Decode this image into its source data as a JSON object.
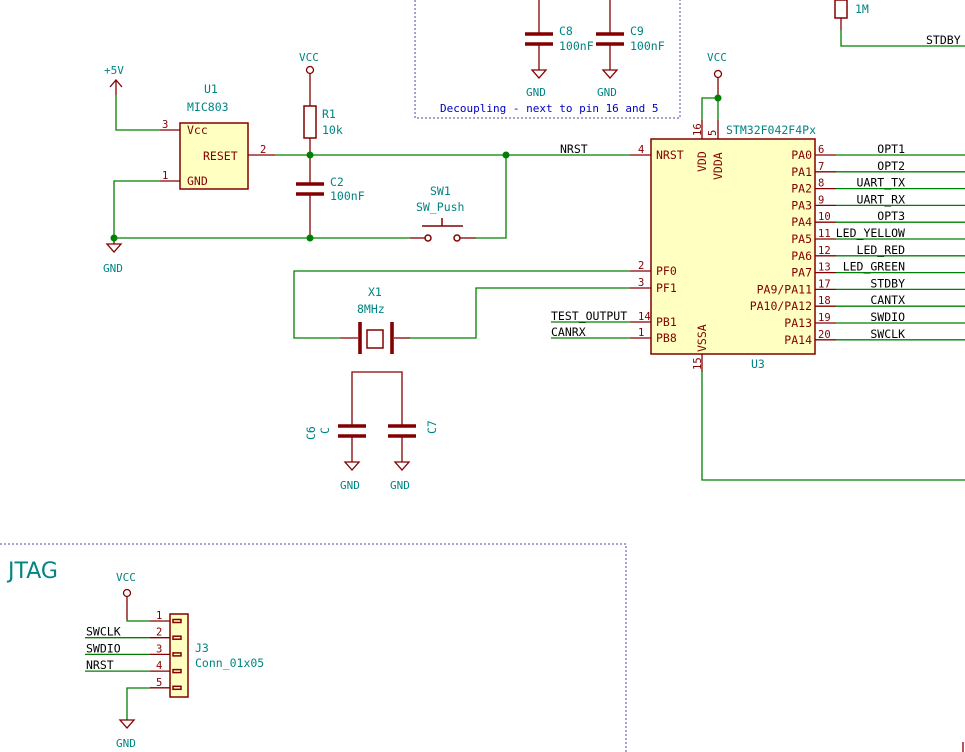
{
  "labels": {
    "plus5v": "+5V",
    "vcc": "VCC",
    "gnd": "GND",
    "decoupling_note": "Decoupling - next to pin 16 and 5",
    "jtag_title": "JTAG"
  },
  "components": {
    "u1": {
      "ref": "U1",
      "value": "MIC803",
      "pins": {
        "vcc": "Vcc",
        "reset": "RESET",
        "gnd": "GND",
        "n3": "3",
        "n2": "2",
        "n1": "1"
      }
    },
    "r1": {
      "ref": "R1",
      "value": "10k"
    },
    "c2": {
      "ref": "C2",
      "value": "100nF"
    },
    "sw1": {
      "ref": "SW1",
      "value": "SW_Push"
    },
    "x1": {
      "ref": "X1",
      "value": "8MHz"
    },
    "c6": {
      "ref": "C6",
      "value": "C"
    },
    "c7": {
      "ref": "C7",
      "value": "C"
    },
    "c8": {
      "ref": "C8",
      "value": "100nF"
    },
    "c9": {
      "ref": "C9",
      "value": "100nF"
    },
    "r_top": {
      "value": "1M"
    },
    "u3": {
      "ref": "U3",
      "value": "STM32F042F4Px",
      "left_pins": [
        {
          "name": "NRST",
          "num": "4"
        },
        {
          "name": "PF0",
          "num": "2"
        },
        {
          "name": "PF1",
          "num": "3"
        },
        {
          "name": "PB1",
          "num": "14"
        },
        {
          "name": "PB8",
          "num": "1"
        }
      ],
      "right_pins": [
        {
          "name": "PA0",
          "num": "6",
          "net": "OPT1"
        },
        {
          "name": "PA1",
          "num": "7",
          "net": "OPT2"
        },
        {
          "name": "PA2",
          "num": "8",
          "net": "UART_TX"
        },
        {
          "name": "PA3",
          "num": "9",
          "net": "UART_RX"
        },
        {
          "name": "PA4",
          "num": "10",
          "net": "OPT3"
        },
        {
          "name": "PA5",
          "num": "11",
          "net": "LED_YELLOW"
        },
        {
          "name": "PA6",
          "num": "12",
          "net": "LED_RED"
        },
        {
          "name": "PA7",
          "num": "13",
          "net": "LED_GREEN"
        },
        {
          "name": "PA9/PA11",
          "num": "17",
          "net": "STDBY"
        },
        {
          "name": "PA10/PA12",
          "num": "18",
          "net": "CANTX"
        },
        {
          "name": "PA13",
          "num": "19",
          "net": "SWDIO"
        },
        {
          "name": "PA14",
          "num": "20",
          "net": "SWCLK"
        }
      ],
      "top_pins": [
        {
          "name": "VDD",
          "num": "16"
        },
        {
          "name": "VDDA",
          "num": "5"
        }
      ],
      "bottom_pins": [
        {
          "name": "VSSA",
          "num": "15"
        }
      ]
    },
    "j3": {
      "ref": "J3",
      "value": "Conn_01x05",
      "pins": [
        {
          "num": "1",
          "net": ""
        },
        {
          "num": "2",
          "net": "SWCLK"
        },
        {
          "num": "3",
          "net": "SWDIO"
        },
        {
          "num": "4",
          "net": "NRST"
        },
        {
          "num": "5",
          "net": ""
        }
      ]
    }
  },
  "nets": {
    "nrst": "NRST",
    "stdby_top": "STDBY",
    "test_output": "TEST_OUTPUT",
    "canrx": "CANRX"
  }
}
